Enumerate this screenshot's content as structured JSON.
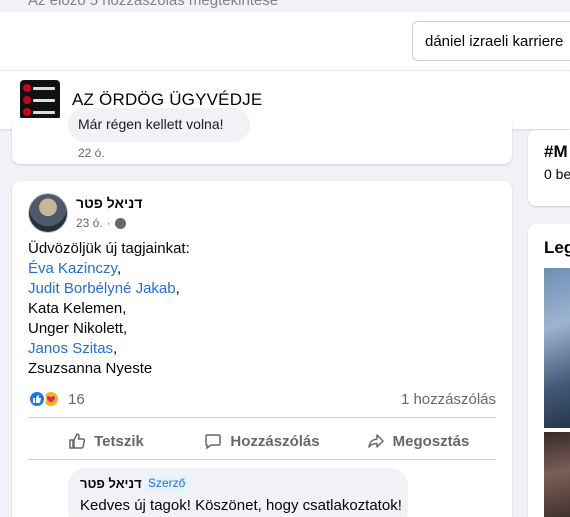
{
  "top_hint": "Az előző 5 hozzászólás megtekintése",
  "search": {
    "value": "dániel izraeli karriere"
  },
  "group": {
    "title": "AZ ÖRDÖG ÜGYVÉDJE"
  },
  "previous_comment": {
    "text": "Már régen kellett volna!",
    "time": "22 ó."
  },
  "right_column": {
    "card1": {
      "hashtag": "#M",
      "subtext": "0 be"
    },
    "card2": {
      "title": "Leg"
    }
  },
  "post": {
    "author": "דניאל פטר",
    "time": "23 ó.",
    "separator": "·",
    "body": [
      {
        "text": "Üdvözöljük új tagjainkat:",
        "link": false,
        "suffix": ""
      },
      {
        "text": "Éva Kazinczy",
        "link": true,
        "suffix": ","
      },
      {
        "text": "Judit Borbélyné Jakab",
        "link": true,
        "suffix": ","
      },
      {
        "text": "Kata Kelemen,",
        "link": false,
        "suffix": ""
      },
      {
        "text": "Unger Nikolett,",
        "link": false,
        "suffix": ""
      },
      {
        "text": "Janos Szitas",
        "link": true,
        "suffix": ","
      },
      {
        "text": "Zsuzsanna Nyeste",
        "link": false,
        "suffix": ""
      }
    ],
    "reaction_count": "16",
    "comment_count": "1 hozzászólás",
    "actions": {
      "like": "Tetszik",
      "comment": "Hozzászólás",
      "share": "Megosztás"
    },
    "comment": {
      "author": "דניאל פטר",
      "badge": "Szerző",
      "text": "Kedves új tagok! Köszönet, hogy csatlakoztatok!"
    }
  },
  "colors": {
    "link": "#216fdb",
    "like": "#1877f2",
    "care": "#f7b125",
    "muted": "#65676b"
  }
}
